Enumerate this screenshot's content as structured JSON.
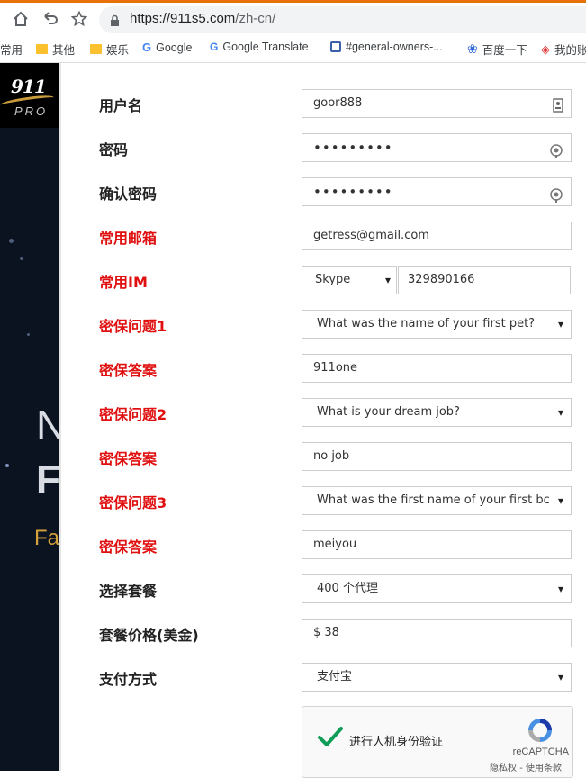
{
  "browser": {
    "url_host": "https://911s5.com",
    "url_path": "/zh-cn/",
    "bookmarks": [
      "常用",
      "其他",
      "娱乐",
      "Google",
      "Google Translate",
      "#general-owners-...",
      "百度一下",
      "我的账"
    ]
  },
  "background": {
    "logo_number": "911",
    "logo_sub": "PRO",
    "hero_letter_1": "N",
    "hero_letter_2": "F",
    "hero_text_3": "Fa"
  },
  "form": {
    "username": {
      "label": "用户名",
      "value": "goor888"
    },
    "password": {
      "label": "密码",
      "value": "•••••••••"
    },
    "confirm_password": {
      "label": "确认密码",
      "value": "•••••••••"
    },
    "email": {
      "label": "常用邮箱",
      "value": "getress@gmail.com"
    },
    "im": {
      "label": "常用IM",
      "type": "Skype",
      "value": "329890166"
    },
    "question1": {
      "label": "密保问题1",
      "value": "What was the name of your first pet?"
    },
    "answer1": {
      "label": "密保答案",
      "value": "911one"
    },
    "question2": {
      "label": "密保问题2",
      "value": "What is your dream job?"
    },
    "answer2": {
      "label": "密保答案",
      "value": "no job"
    },
    "question3": {
      "label": "密保问题3",
      "value": "What was the first name of your first bc"
    },
    "answer3": {
      "label": "密保答案",
      "value": "meiyou"
    },
    "package": {
      "label": "选择套餐",
      "value": "400 个代理"
    },
    "price": {
      "label": "套餐价格(美金)",
      "value": "$ 38"
    },
    "payment": {
      "label": "支付方式",
      "value": "支付宝"
    }
  },
  "captcha": {
    "label": "进行人机身份验证",
    "brand": "reCAPTCHA",
    "links": "隐私权 - 使用条款"
  },
  "colors": {
    "required_label": "#e01010",
    "accent": "#e8710a",
    "captcha_check": "#0f9d58"
  }
}
